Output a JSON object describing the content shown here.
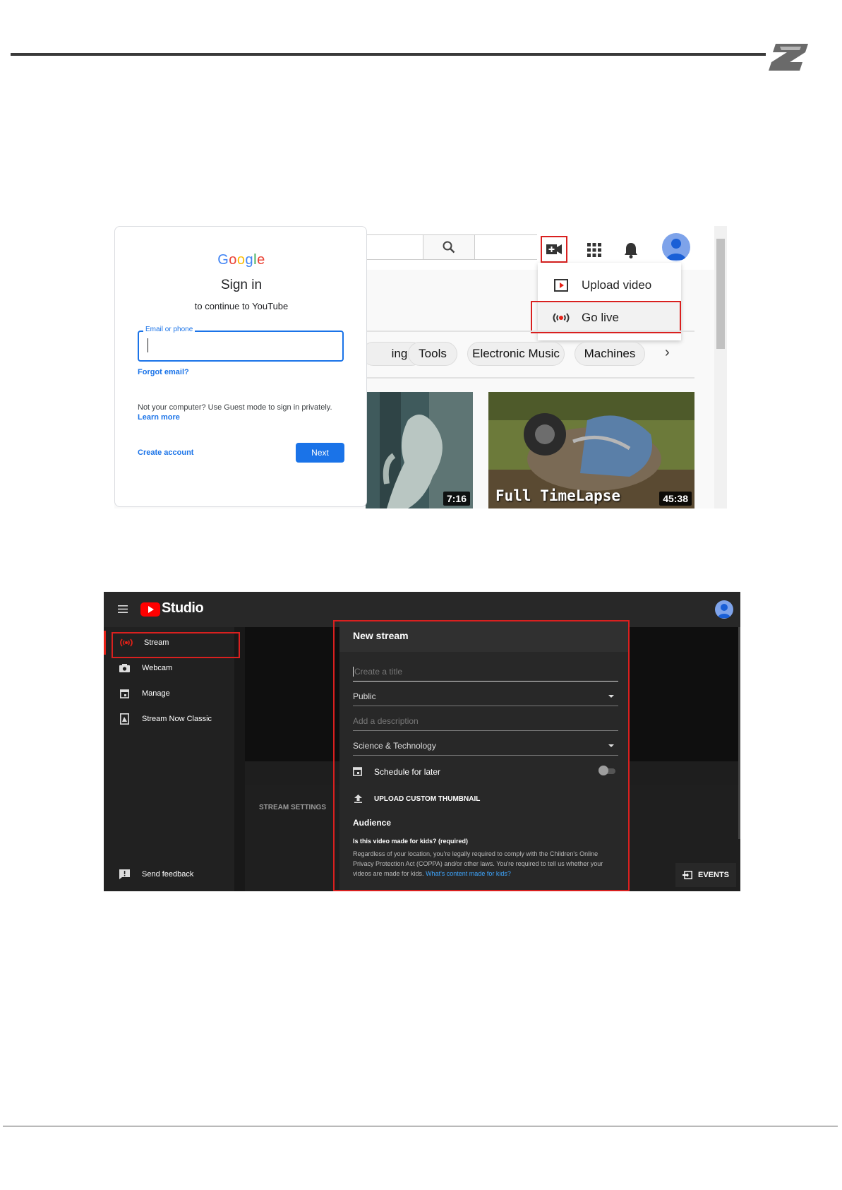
{
  "signin": {
    "logo": "Google",
    "title": "Sign in",
    "subtitle": "to continue to YouTube",
    "email_label": "Email or phone",
    "forgot_email": "Forgot email?",
    "guest_note": "Not your computer? Use Guest mode to sign in privately.",
    "learn_more": "Learn more",
    "create_account": "Create account",
    "next": "Next"
  },
  "youtube": {
    "menu": {
      "upload_video": "Upload video",
      "go_live": "Go live"
    },
    "chips": [
      "ing",
      "Tools",
      "Electronic Music",
      "Machines"
    ],
    "chip_next": "›",
    "videos": [
      {
        "duration": "7:16"
      },
      {
        "title_overlay": "Full TimeLapse",
        "duration": "45:38"
      }
    ],
    "colors": {
      "highlight": "#d9201f",
      "avatar": "#7ea3ea"
    }
  },
  "studio": {
    "brand": "Studio",
    "sidebar": [
      {
        "label": "Stream",
        "icon": "broadcast-icon"
      },
      {
        "label": "Webcam",
        "icon": "camera-icon"
      },
      {
        "label": "Manage",
        "icon": "calendar-icon"
      },
      {
        "label": "Stream Now Classic",
        "icon": "classic-icon"
      }
    ],
    "send_feedback": "Send feedback",
    "stream_settings": "STREAM SETTINGS",
    "events": "EVENTS",
    "new_stream": {
      "heading": "New stream",
      "title_placeholder": "Create a title",
      "visibility": "Public",
      "description_placeholder": "Add a description",
      "category": "Science & Technology",
      "schedule": "Schedule for later",
      "upload_thumbnail": "UPLOAD CUSTOM THUMBNAIL",
      "audience": "Audience",
      "kids_question": "Is this video made for kids? (required)",
      "kids_text": "Regardless of your location, you're legally required to comply with the Children's Online Privacy Protection Act (COPPA) and/or other laws. You're required to tell us whether your videos are made for kids.",
      "kids_link": "What's content made for kids?"
    }
  }
}
